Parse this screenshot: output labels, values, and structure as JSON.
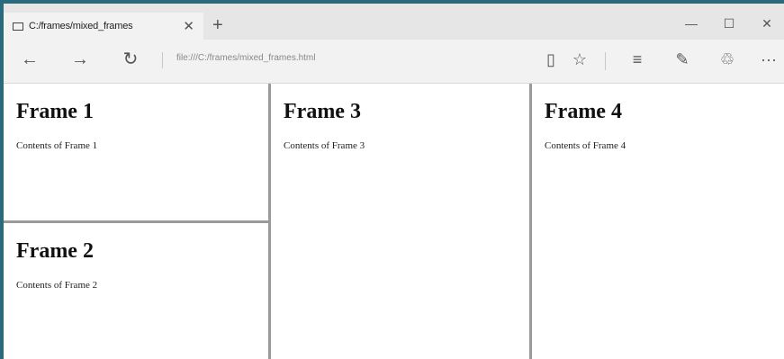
{
  "tab": {
    "title": "C:/frames/mixed_frames",
    "close": "✕",
    "new_tab": "+"
  },
  "window_controls": {
    "minimize": "—",
    "maximize": "☐",
    "close": "✕"
  },
  "nav": {
    "back": "←",
    "forward": "→",
    "refresh": "↻"
  },
  "address": {
    "url": "file:///C:/frames/mixed_frames.html"
  },
  "toolbar": {
    "reading_view": "▯",
    "favorite": "☆",
    "hub": "≡",
    "web_note": "✎",
    "share": "♲",
    "more": "···"
  },
  "frames": [
    {
      "heading": "Frame 1",
      "text": "Contents of Frame 1"
    },
    {
      "heading": "Frame 2",
      "text": "Contents of Frame 2"
    },
    {
      "heading": "Frame 3",
      "text": "Contents of Frame 3"
    },
    {
      "heading": "Frame 4",
      "text": "Contents of Frame 4"
    }
  ],
  "colors": {
    "frame_border": "#9a9a9a",
    "window_accent": "#2b6a7a",
    "chrome_bg": "#f2f2f2"
  }
}
